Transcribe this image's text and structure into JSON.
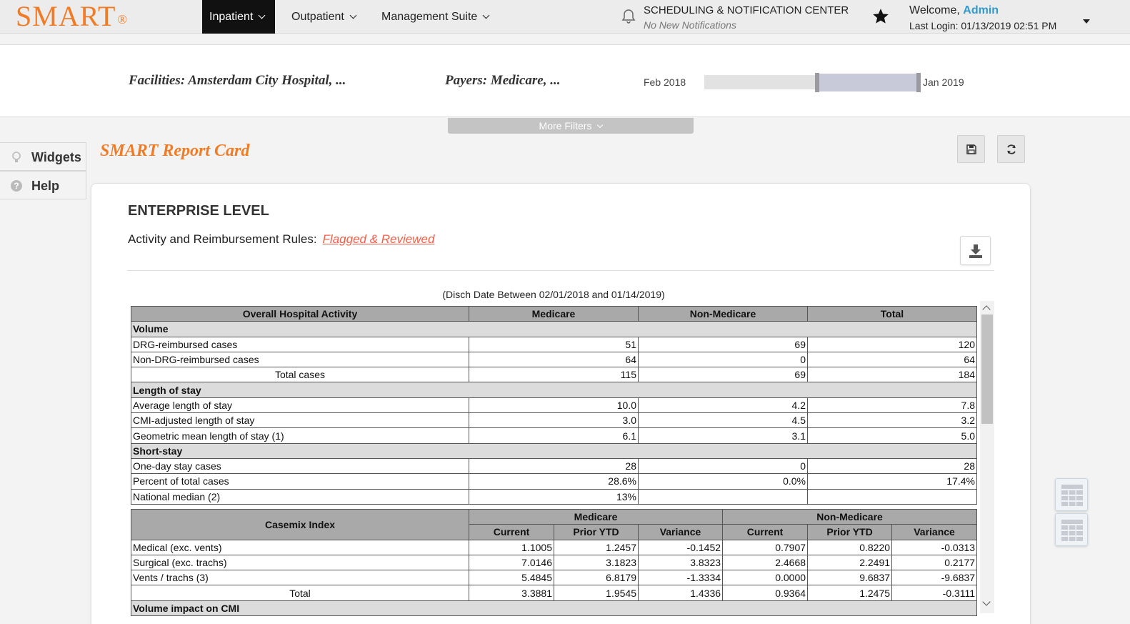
{
  "header": {
    "logo": "SMART",
    "logo_mark": "®",
    "nav": [
      "Inpatient",
      "Outpatient",
      "Management Suite"
    ],
    "scheduling_title": "SCHEDULING & NOTIFICATION CENTER",
    "scheduling_sub": "No New Notifications",
    "welcome_prefix": "Welcome, ",
    "user": "Admin",
    "last_login": "Last Login: 01/13/2019 02:51 PM"
  },
  "filters": {
    "facilities": "Facilities: Amsterdam City Hospital, ...",
    "payers": "Payers: Medicare, ...",
    "range_start": "Feb 2018",
    "range_end": "Jan 2019",
    "more_filters": "More Filters"
  },
  "sidebar": {
    "items": [
      "Widgets",
      "Help"
    ]
  },
  "page": {
    "title": "SMART Report Card",
    "section_title": "ENTERPRISE LEVEL",
    "rules_label": "Activity and Reimbursement Rules:",
    "rules_link": "Flagged & Reviewed",
    "caption": "(Disch Date Between 02/01/2018 and 01/14/2019)"
  },
  "activity_table": {
    "headers": [
      "Overall Hospital Activity",
      "Medicare",
      "Non-Medicare",
      "Total"
    ],
    "sections": [
      {
        "title": "Volume",
        "rows": [
          {
            "label": "DRG-reimbursed cases",
            "v": [
              "51",
              "69",
              "120"
            ]
          },
          {
            "label": "Non-DRG-reimbursed cases",
            "v": [
              "64",
              "0",
              "64"
            ]
          },
          {
            "label": "Total cases",
            "v": [
              "115",
              "69",
              "184"
            ],
            "total": true
          }
        ]
      },
      {
        "title": "Length of stay",
        "rows": [
          {
            "label": "Average length of stay",
            "v": [
              "10.0",
              "4.2",
              "7.8"
            ]
          },
          {
            "label": "CMI-adjusted length of stay",
            "v": [
              "3.0",
              "4.5",
              "3.2"
            ]
          },
          {
            "label": "Geometric mean length of stay (1)",
            "v": [
              "6.1",
              "3.1",
              "5.0"
            ]
          }
        ]
      },
      {
        "title": "Short-stay",
        "rows": [
          {
            "label": "One-day stay cases",
            "v": [
              "28",
              "0",
              "28"
            ]
          },
          {
            "label": "Percent of total cases",
            "v": [
              "28.6%",
              "0.0%",
              "17.4%"
            ]
          },
          {
            "label": "National median (2)",
            "v": [
              "13%",
              "",
              ""
            ]
          }
        ]
      }
    ]
  },
  "casemix_table": {
    "title": "Casemix Index",
    "groups": [
      "Medicare",
      "Non-Medicare"
    ],
    "subheaders": [
      "Current",
      "Prior YTD",
      "Variance",
      "Current",
      "Prior YTD",
      "Variance"
    ],
    "rows": [
      {
        "label": "Medical (exc. vents)",
        "v": [
          "1.1005",
          "1.2457",
          "-0.1452",
          "0.7907",
          "0.8220",
          "-0.0313"
        ]
      },
      {
        "label": "Surgical (exc. trachs)",
        "v": [
          "7.0146",
          "3.1823",
          "3.8323",
          "2.4668",
          "2.2491",
          "0.2177"
        ]
      },
      {
        "label": "Vents / trachs (3)",
        "v": [
          "5.4845",
          "6.8179",
          "-1.3334",
          "0.0000",
          "9.6837",
          "-9.6837"
        ]
      },
      {
        "label": "Total",
        "v": [
          "3.3881",
          "1.9545",
          "1.4336",
          "0.9364",
          "1.2475",
          "-0.3111"
        ],
        "total": true
      }
    ],
    "next_section": "Volume impact on CMI"
  },
  "colors": {
    "brand": "#f07c28",
    "link": "#f05f4a",
    "accent": "#3399cc"
  }
}
